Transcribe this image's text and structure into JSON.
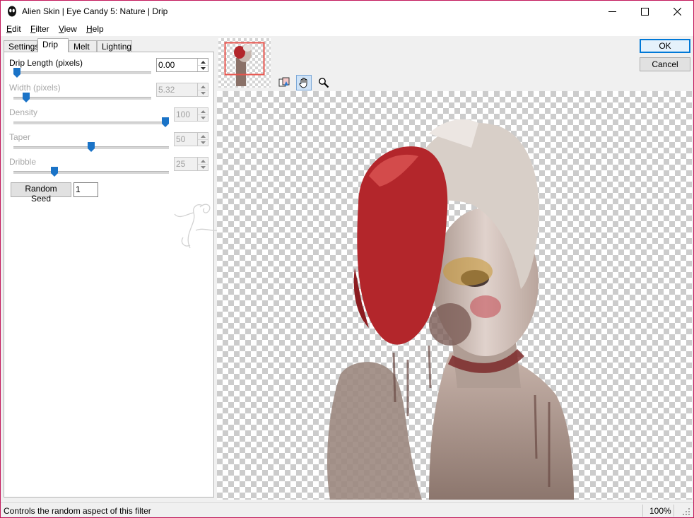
{
  "window": {
    "title": "Alien Skin | Eye Candy 5: Nature | Drip",
    "accent_color": "#c2185b"
  },
  "menu": {
    "items": [
      {
        "label": "Edit",
        "mnemonic": "E",
        "rest": "dit"
      },
      {
        "label": "Filter",
        "mnemonic": "F",
        "rest": "ilter"
      },
      {
        "label": "View",
        "mnemonic": "V",
        "rest": "iew"
      },
      {
        "label": "Help",
        "mnemonic": "H",
        "rest": "elp"
      }
    ]
  },
  "tabs": [
    {
      "label": "Settings",
      "active": false
    },
    {
      "label": "Drip",
      "active": true
    },
    {
      "label": "Melt",
      "active": false
    },
    {
      "label": "Lighting",
      "active": false
    }
  ],
  "params": {
    "drip_length": {
      "label": "Drip Length (pixels)",
      "value": "0.00",
      "enabled": true,
      "slider_fraction": 0.0
    },
    "width": {
      "label": "Width (pixels)",
      "value": "5.32",
      "enabled": false,
      "slider_fraction": 0.07
    },
    "density": {
      "label": "Density",
      "value": "100",
      "enabled": false,
      "slider_fraction": 1.0
    },
    "taper": {
      "label": "Taper",
      "value": "50",
      "enabled": false,
      "slider_fraction": 0.5
    },
    "dribble": {
      "label": "Dribble",
      "value": "25",
      "enabled": false,
      "slider_fraction": 0.25
    }
  },
  "random_seed": {
    "button_label": "Random Seed",
    "value": "1"
  },
  "dialog_buttons": {
    "ok": "OK",
    "cancel": "Cancel"
  },
  "preview_tools": [
    {
      "icon": "compare-icon",
      "active": false
    },
    {
      "icon": "hand-icon",
      "active": true
    },
    {
      "icon": "zoom-icon",
      "active": false
    }
  ],
  "status": {
    "message": "Controls the random aspect of this filter",
    "zoom": "100%"
  },
  "colors": {
    "slider_thumb": "#1a73c7",
    "thumbnail_frame": "#e8554e",
    "default_button_border": "#0078d7"
  }
}
